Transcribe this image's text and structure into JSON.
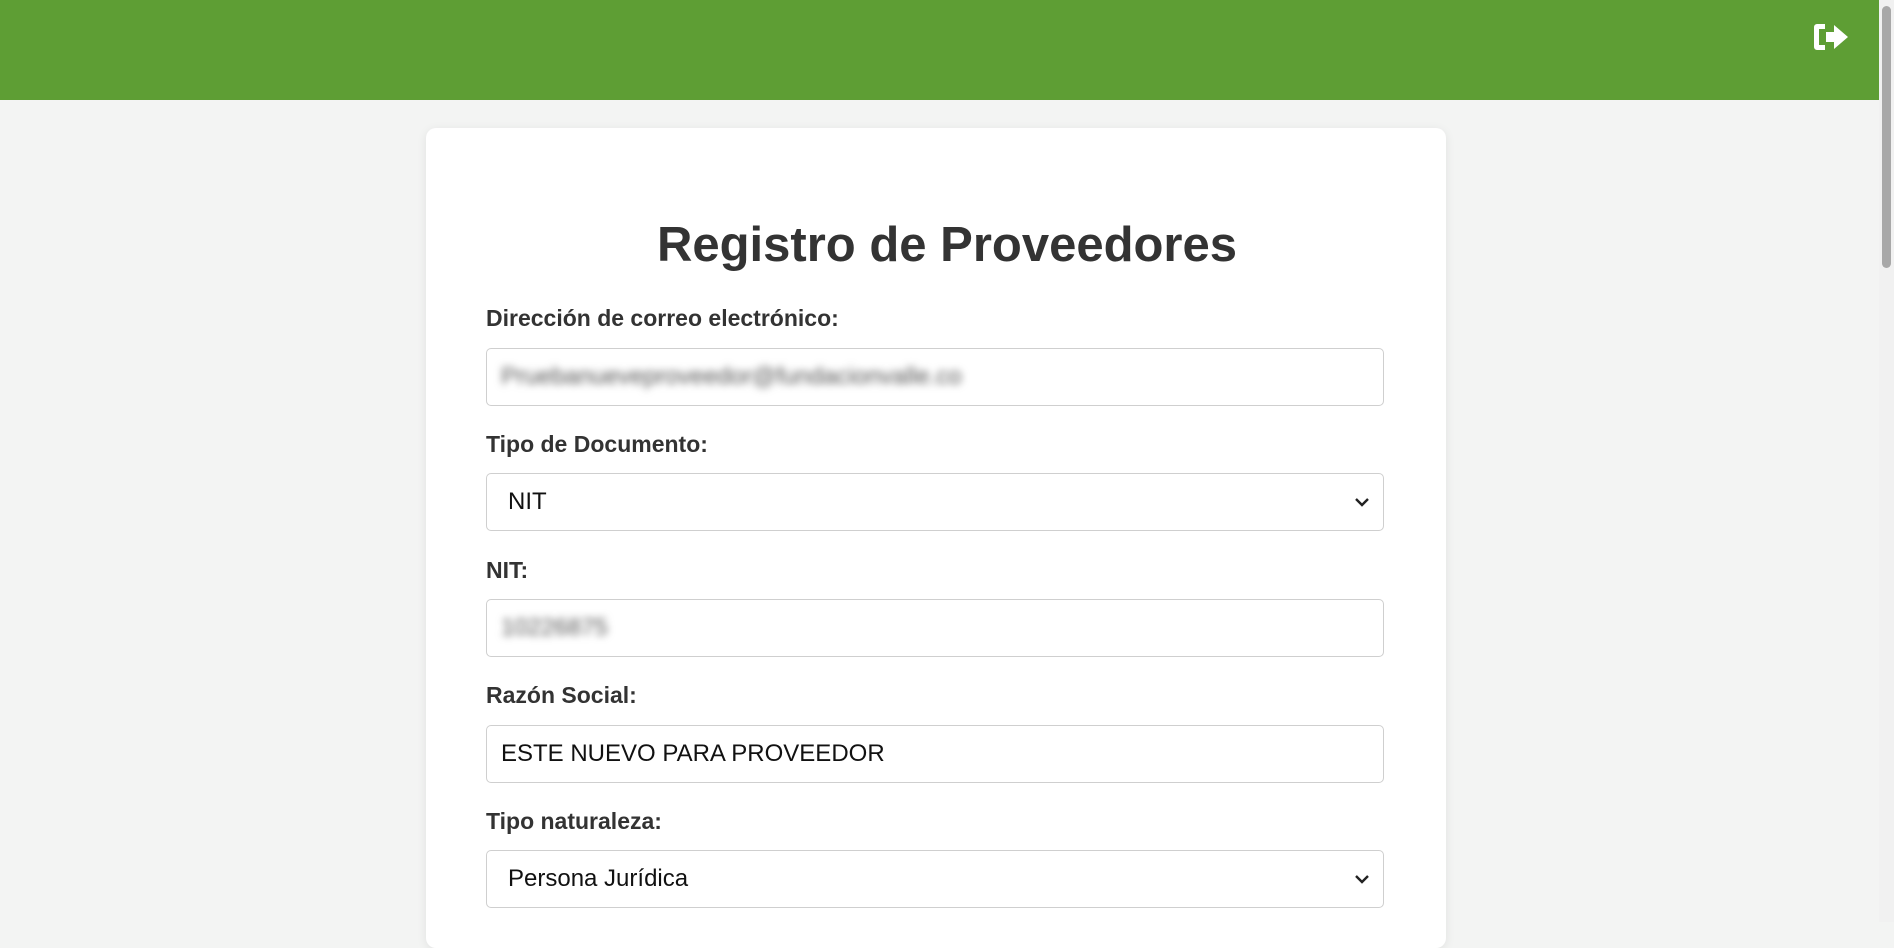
{
  "header": {
    "color": "#5e9e34",
    "logout_icon": "sign-out-icon"
  },
  "form": {
    "title": "Registro de Proveedores",
    "email": {
      "label": "Dirección de correo electrónico:",
      "value": "Pruebanueveproveedor@fundacionvalle.co"
    },
    "document_type": {
      "label": "Tipo de Documento:",
      "value": "NIT"
    },
    "nit": {
      "label": "NIT:",
      "value": "10226875"
    },
    "razon_social": {
      "label": "Razón Social:",
      "value": "ESTE NUEVO PARA PROVEEDOR"
    },
    "nature_type": {
      "label": "Tipo naturaleza:",
      "value": "Persona Jurídica"
    }
  }
}
